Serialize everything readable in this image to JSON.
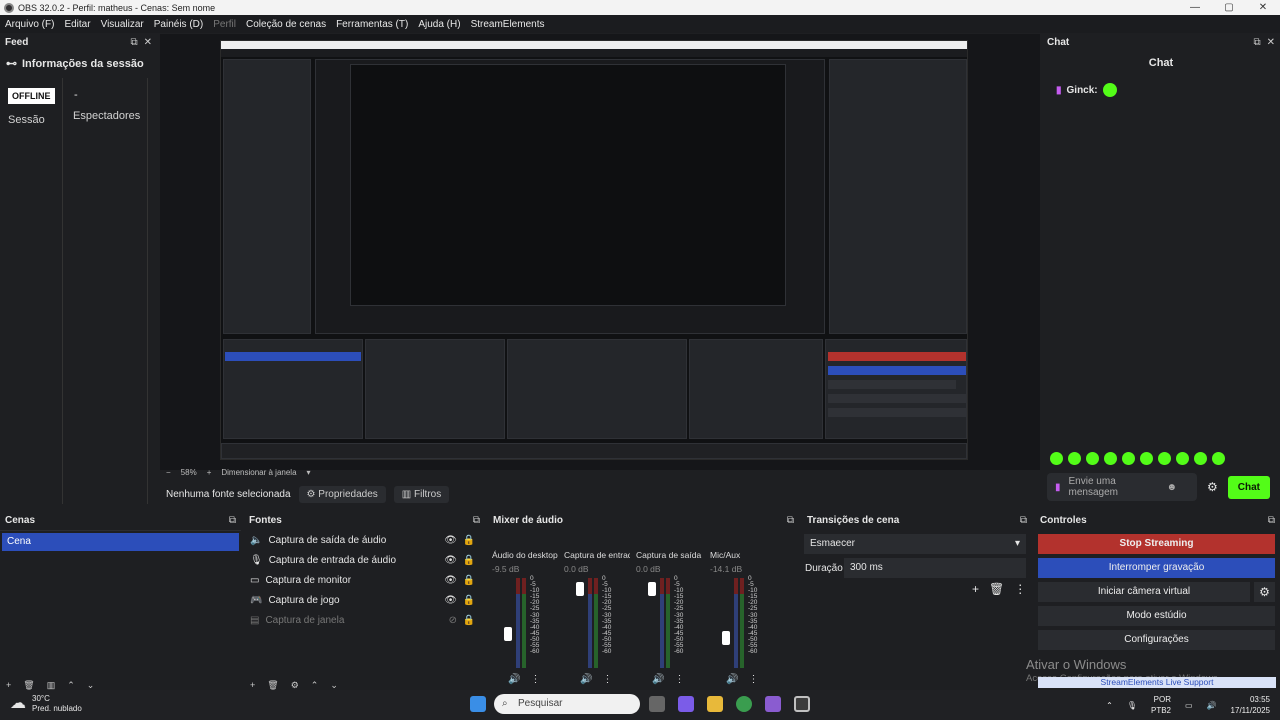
{
  "window": {
    "title": "OBS 32.0.2 - Perfil: matheus - Cenas: Sem nome",
    "controls": [
      "—",
      "▢",
      "✕"
    ]
  },
  "menu": {
    "items": [
      "Arquivo (F)",
      "Editar",
      "Visualizar",
      "Painéis (D)",
      "Perfil",
      "Coleção de cenas",
      "Ferramentas (T)",
      "Ajuda (H)",
      "StreamElements"
    ]
  },
  "feed": {
    "title": "Feed",
    "session_title": "Informações da sessão",
    "status": "OFFLINE",
    "session_value": "-",
    "session_label": "Sessão",
    "viewers_label": "Espectadores"
  },
  "preview": {
    "zoom": "58%",
    "scale_mode": "Dimensionar à janela",
    "no_source": "Nenhuma fonte selecionada",
    "properties": "Propriedades",
    "filters": "Filtros"
  },
  "chat": {
    "title": "Chat",
    "heading": "Chat",
    "message_user": "Ginck:",
    "input_placeholder": "Envie uma mensagem",
    "send_label": "Chat"
  },
  "scenes": {
    "title": "Cenas",
    "items": [
      "Cena"
    ]
  },
  "sources": {
    "title": "Fontes",
    "items": [
      {
        "label": "Captura de saída de áudio",
        "icon": "speaker-icon"
      },
      {
        "label": "Captura de entrada de áudio",
        "icon": "microphone-icon"
      },
      {
        "label": "Captura de monitor",
        "icon": "monitor-icon"
      },
      {
        "label": "Captura de jogo",
        "icon": "gamepad-icon"
      },
      {
        "label": "Captura de janela",
        "icon": "window-icon"
      }
    ]
  },
  "mixer": {
    "title": "Mixer de áudio",
    "channels": [
      {
        "name": "Áudio do desktop",
        "db": "-9.5 dB",
        "level": 0.35
      },
      {
        "name": "Captura de entrada",
        "db": "0.0 dB",
        "level": 0.95
      },
      {
        "name": "Captura de saída d",
        "db": "0.0 dB",
        "level": 0.95
      },
      {
        "name": "Mic/Aux",
        "db": "-14.1 dB",
        "level": 0.3
      }
    ],
    "scale": [
      "0",
      "-5",
      "-10",
      "-15",
      "-20",
      "-25",
      "-30",
      "-35",
      "-40",
      "-45",
      "-50",
      "-55",
      "-60"
    ]
  },
  "transitions": {
    "title": "Transições de cena",
    "selected": "Esmaecer",
    "duration_label": "Duração",
    "duration_value": "300 ms"
  },
  "controls": {
    "title": "Controles",
    "stop_streaming": "Stop Streaming",
    "stop_recording": "Interromper gravação",
    "virtual_cam": "Iniciar câmera virtual",
    "studio_mode": "Modo estúdio",
    "settings": "Configurações",
    "colors": {
      "stop": "#b3322d",
      "record": "#2c4eba"
    }
  },
  "overlay": {
    "activate_title": "Ativar o Windows",
    "activate_sub": "Acesse Configurações para ativar o Windows.",
    "se_support": "StreamElements Live Support"
  },
  "taskbar": {
    "weather_temp": "30°C",
    "weather_desc": "Pred. nublado",
    "search_placeholder": "Pesquisar",
    "lang": "POR",
    "layout": "PTB2",
    "time": "03:55",
    "date": "17/11/2025"
  }
}
